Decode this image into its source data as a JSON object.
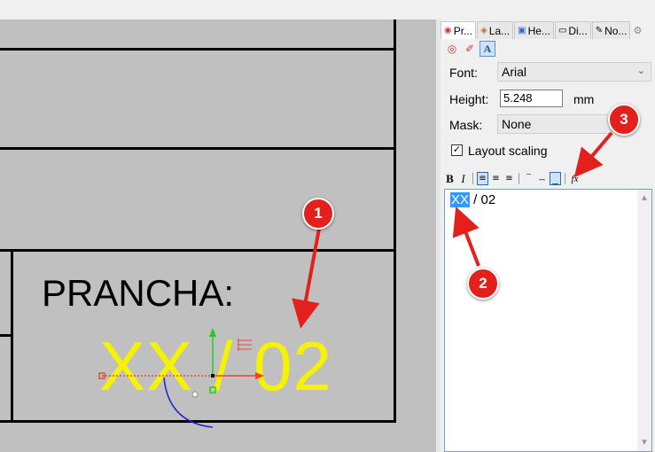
{
  "viewport": {
    "label_text": "PRANCHA:",
    "field_text": "XX / 02"
  },
  "panel": {
    "tabs": [
      {
        "label": "Pr...",
        "icon": "properties-icon"
      },
      {
        "label": "La...",
        "icon": "layers-icon"
      },
      {
        "label": "He...",
        "icon": "help-icon"
      },
      {
        "label": "Di...",
        "icon": "display-icon"
      },
      {
        "label": "No...",
        "icon": "notes-icon"
      }
    ],
    "font_label": "Font:",
    "font_value": "Arial",
    "height_label": "Height:",
    "height_value": "5.248",
    "height_unit": "mm",
    "mask_label": "Mask:",
    "mask_value": "None",
    "layout_scaling_label": "Layout scaling",
    "layout_scaling_checked": true,
    "toolbar": {
      "bold": "B",
      "italic": "I",
      "fx": "fx"
    },
    "editor": {
      "selected": "XX",
      "rest": " / 02"
    }
  },
  "annotations": {
    "badge1": "1",
    "badge2": "2",
    "badge3": "3"
  },
  "colors": {
    "viewport_bg": "#c0c0c0",
    "text_yellow": "#f7f300",
    "badge_red": "#e3201b",
    "selection_blue": "#3399ff"
  }
}
